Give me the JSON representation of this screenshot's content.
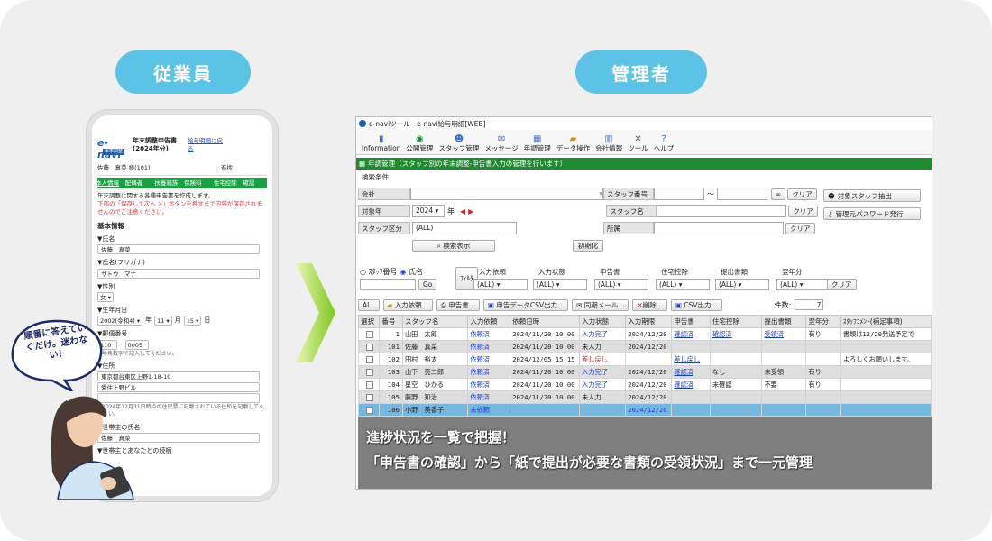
{
  "labels": {
    "employee": "従業員",
    "admin": "管理者"
  },
  "phone": {
    "logo": "e-navi",
    "logo_sub": "年末調整",
    "title": "年末調整申告書(2024年分)",
    "link": "給与明細に戻る",
    "user": "佐藤　真菜 様(101)",
    "progress": "進捗",
    "tabs": [
      "本人情報",
      "配偶者",
      "扶養親族",
      "保険料",
      "住宅控除",
      "確認"
    ],
    "intro": "年末調整に関する各種申告書を作成します。",
    "warn": "下部の「保存して次へ >」ボタンを押すまで内容が保存されませんのでご注意ください。",
    "section": "基本情報",
    "name_label": "▼氏名",
    "name_value": "佐藤　真菜",
    "kana_label": "▼氏名(フリガナ)",
    "kana_value": "サトウ　マナ",
    "sex_label": "▼性別",
    "sex_value": "女",
    "birth_label": "▼生年月日",
    "birth_era": "2002(令和4)",
    "birth_month": "11",
    "birth_day": "15",
    "y": "年",
    "m": "月",
    "d": "日",
    "zip_label": "▼郵便番号",
    "zip1": "110",
    "zip2": "0005",
    "zip_note": "※半角数字で記入してください。",
    "addr_label": "▼住所",
    "addr1": "東京都台東区上野1-18-10",
    "addr2": "愛住上野ビル",
    "addr_note": "※2024年12月31日時点の住民票に記載されている住所を記載してください。",
    "head_label": "▼世帯主の氏名",
    "head_value": "佐藤　真菜",
    "rel_label": "▼世帯主とあなたとの続柄"
  },
  "bubble": "順番に答えていくだけ。迷わない！",
  "window": {
    "title": "e-naviツール - e-navi給与明細[WEB]",
    "toolbar": [
      "Information",
      "公開管理",
      "スタッフ管理",
      "メッセージ",
      "年調管理",
      "データ操作",
      "会社情報",
      "ツール",
      "ヘルプ"
    ],
    "green": "年調管理（スタッフ別の年末調整-申告書入力の管理を行います）",
    "search_title": "検索条件",
    "company": "会社",
    "year_label": "対象年",
    "year": "2024",
    "year_unit": "年",
    "staff_kbn": "スタッフ区分",
    "all": "(ALL)",
    "staff_no": "スタッフ番号",
    "tilde": "〜",
    "inf": "∞",
    "clear": "クリア",
    "staff_name": "スタッフ名",
    "dept": "所属",
    "search_btn": "検索表示",
    "reset_btn": "初期化",
    "extract_btn": "対象スタッフ抽出",
    "pw_btn": "管理元パスワード発行",
    "radio1": "ｽﾀｯﾌ番号",
    "radio2": "氏名",
    "go": "Go",
    "filter": "ﾌｨﾙﾀ",
    "filter_cols": [
      "入力依頼",
      "入力状態",
      "申告書",
      "住宅控除",
      "提出書類",
      "翌年分"
    ],
    "act_all": "ALL",
    "act1": "入力依頼...",
    "act2": "申告書...",
    "act3": "申告データCSV出力...",
    "act4": "同期メール...",
    "act5": "削除...",
    "act6": "CSV出力...",
    "count_label": "件数:",
    "count": "7",
    "headers": [
      "選択",
      "番号",
      "スタッフ名",
      "入力依頼",
      "依頼日時",
      "入力状態",
      "入力期限",
      "申告書",
      "住宅控除",
      "提出書類",
      "翌年分",
      "ｽﾀｯﾌｺﾒﾝﾄ(補足事項)"
    ],
    "rows": [
      [
        "",
        "1",
        "山田　太郎",
        "依頼済",
        "2024/11/20 10:00",
        "入力完了",
        "2024/12/20",
        "確認済",
        "確認済",
        "受領済",
        "有り",
        "書類は12/20発送予定で"
      ],
      [
        "",
        "101",
        "佐藤　真菜",
        "依頼済",
        "2024/11/20 10:00",
        "未入力",
        "2024/12/20",
        "",
        "",
        "",
        "",
        ""
      ],
      [
        "",
        "102",
        "田村　裕太",
        "依頼済",
        "2024/12/05 15:15",
        "差し戻し",
        "",
        "差し戻し",
        "",
        "",
        "",
        "よろしくお願いします。"
      ],
      [
        "",
        "103",
        "山下　亮二郎",
        "依頼済",
        "2024/11/20 10:00",
        "入力完了",
        "2024/12/20",
        "確認済",
        "なし",
        "未受領",
        "有り",
        ""
      ],
      [
        "",
        "104",
        "星空　ひかる",
        "依頼済",
        "2024/11/20 10:00",
        "入力完了",
        "2024/12/20",
        "確認済",
        "未確認",
        "不要",
        "有り",
        ""
      ],
      [
        "",
        "105",
        "藤野　知治",
        "依頼済",
        "2024/11/20 10:00",
        "未入力",
        "2024/12/20",
        "",
        "",
        "",
        "",
        ""
      ],
      [
        "",
        "106",
        "小野　美香子",
        "未依頼",
        "",
        "",
        "2024/12/20",
        "",
        "",
        "",
        "",
        ""
      ]
    ]
  },
  "captions": {
    "line1": "進捗状況を一覧で把握！",
    "line2": "「申告書の確認」から「紙で提出が必要な書類の受領状況」まで一元管理"
  },
  "colors": {
    "accent": "#5bc4e6",
    "green": "#1c8c2c",
    "link": "#1a3fd0",
    "red": "#e0202a",
    "selected": "#74b8df"
  }
}
